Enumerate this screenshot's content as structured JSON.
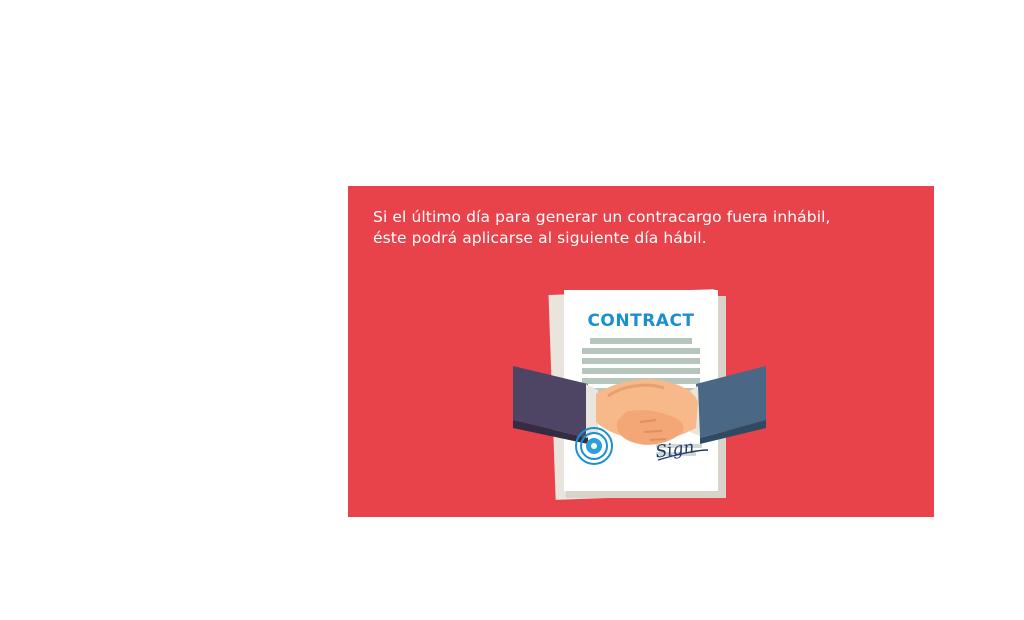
{
  "card": {
    "line1": "Si el último día para generar un contracargo fuera inhábil,",
    "line2": "éste podrá aplicarse al siguiente día hábil."
  },
  "illustration": {
    "contract_title": "CONTRACT",
    "sign_label": "Sign"
  },
  "colors": {
    "card_background": "#e8424a",
    "text": "#ffffff",
    "contract_title": "#1a8fd1",
    "sleeve_left": "#4e4464",
    "sleeve_right": "#4a6786",
    "skin": "#f7b88a"
  }
}
